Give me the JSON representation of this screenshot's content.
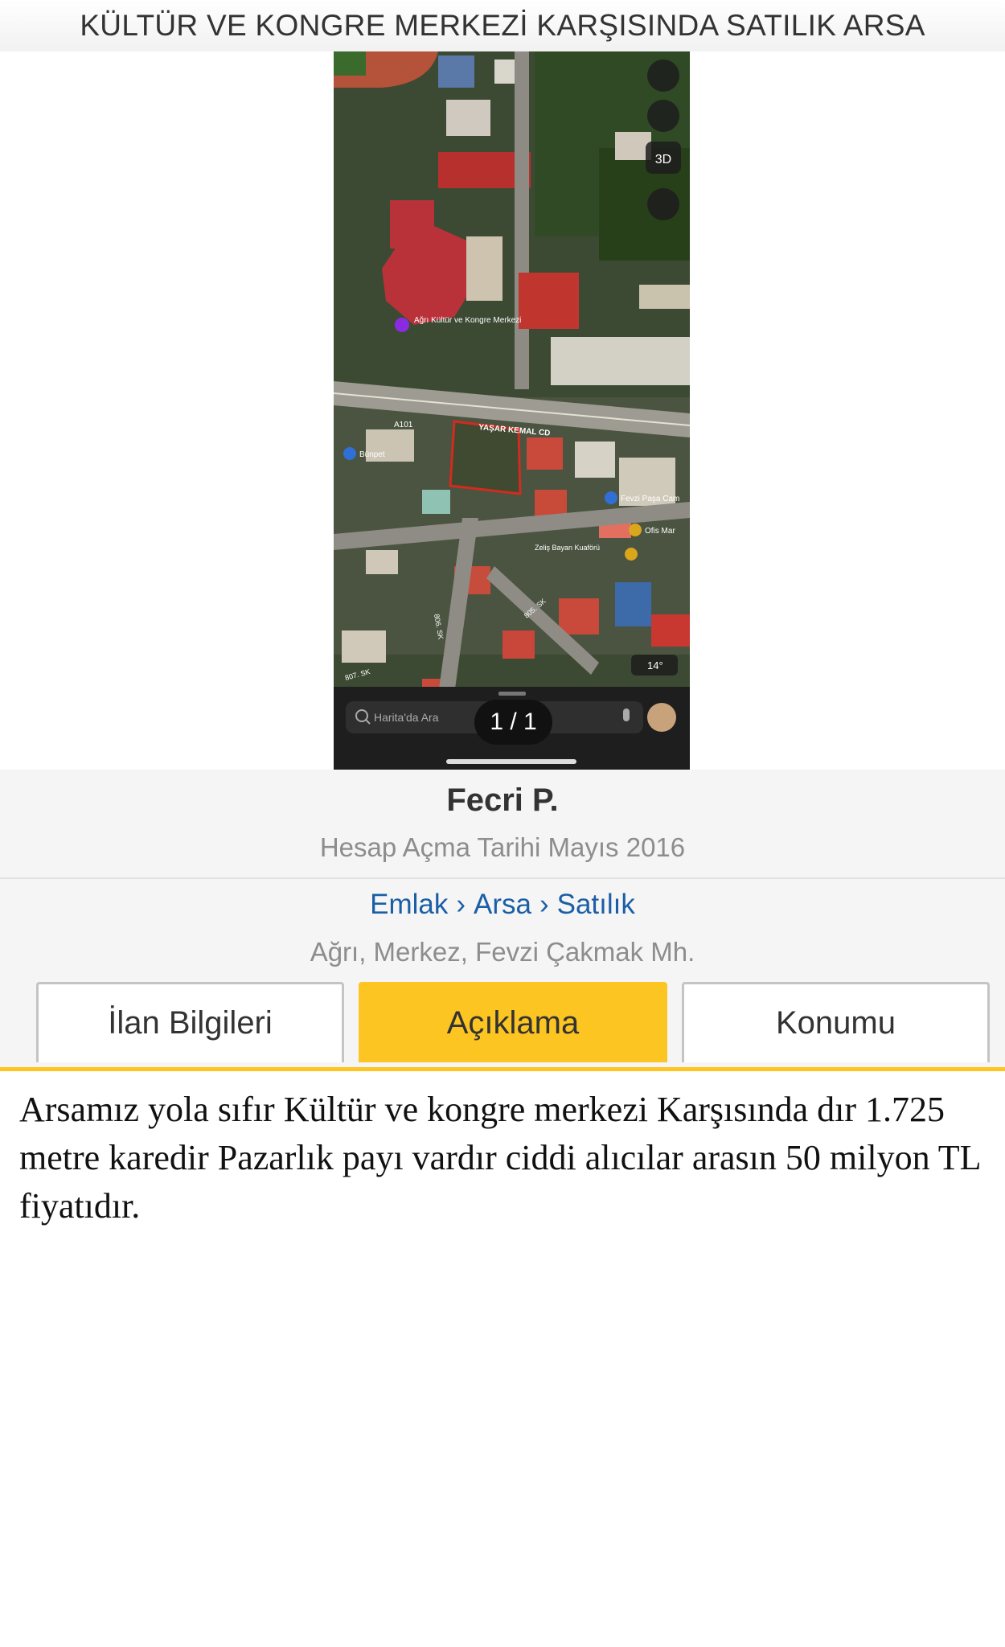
{
  "title": "KÜLTÜR VE KONGRE MERKEZİ KARŞISINDA SATILIK ARSA",
  "gallery": {
    "counter": "1 / 1",
    "map_labels": {
      "kultur_merkezi": "Ağrı Kültür ve Kongre Merkezi",
      "street": "YAŞAR KEMAL CD",
      "market_a101": "A101",
      "market_bunpet": "Bünpet",
      "mosque": "Fevzi Paşa Cam",
      "ofis": "Ofis Mar",
      "zelis": "Zeliş Bayan Kuaförü",
      "street_806": "806. SK",
      "street_805": "805. SK",
      "street_807": "807. SK",
      "weather": "14°",
      "btn_3d": "3D",
      "search_placeholder": "Harita'da Ara"
    }
  },
  "seller": {
    "name": "Fecri P.",
    "since": "Hesap Açma Tarihi Mayıs 2016"
  },
  "breadcrumb": [
    "Emlak",
    "Arsa",
    "Satılık"
  ],
  "breadcrumb_sep": "›",
  "location": "Ağrı, Merkez, Fevzi Çakmak Mh.",
  "tabs": [
    {
      "label": "İlan Bilgileri",
      "active": false
    },
    {
      "label": "Açıklama",
      "active": true
    },
    {
      "label": "Konumu",
      "active": false
    }
  ],
  "description": "Arsamız yola sıfır Kültür ve kongre merkezi Karşısında dır 1.725 metre karedir Pazarlık payı vardır ciddi alıcılar arasın 50 milyon TL fiyatıdır.",
  "colors": {
    "accent_yellow": "#fdc521",
    "link_blue": "#1c5ea6",
    "plot_outline": "#d42a1f"
  }
}
